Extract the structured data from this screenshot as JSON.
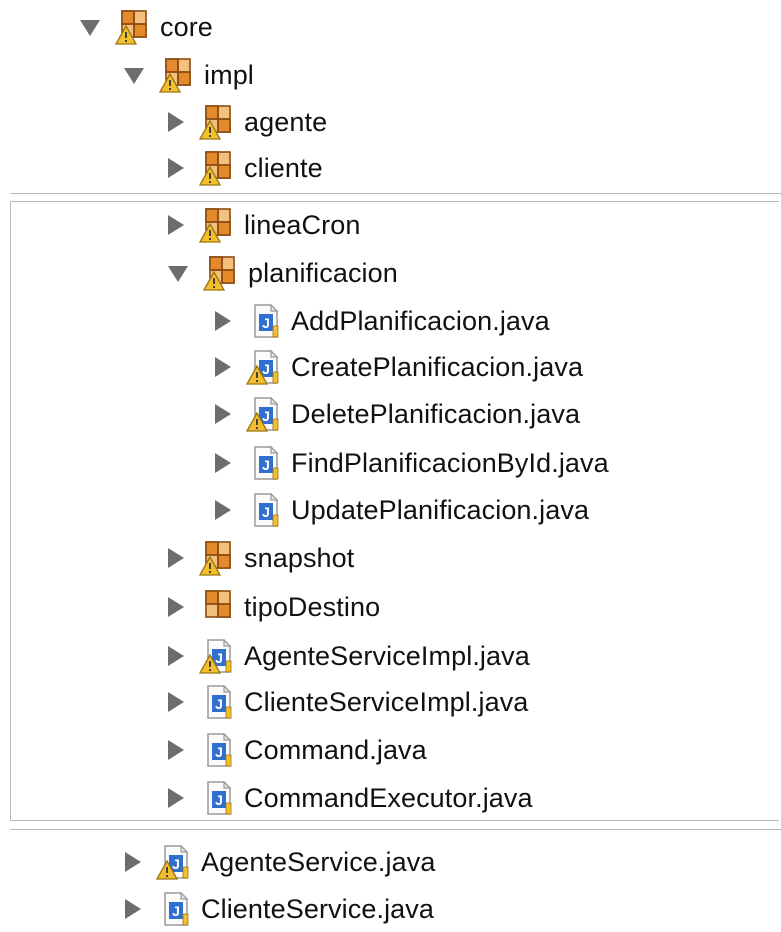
{
  "tree": {
    "core": {
      "label": "core",
      "icon": "package-warning-icon",
      "state": "expanded"
    },
    "impl": {
      "label": "impl",
      "icon": "package-warning-icon",
      "state": "expanded"
    },
    "agente": {
      "label": "agente",
      "icon": "package-warning-icon",
      "state": "collapsed"
    },
    "cliente": {
      "label": "cliente",
      "icon": "package-warning-icon",
      "state": "collapsed"
    },
    "lineaCron": {
      "label": "lineaCron",
      "icon": "package-warning-icon",
      "state": "collapsed"
    },
    "planificacion": {
      "label": "planificacion",
      "icon": "package-warning-icon",
      "state": "expanded"
    },
    "addPlanificacion": {
      "label": "AddPlanificacion.java",
      "icon": "java-file-icon",
      "state": "collapsed"
    },
    "createPlanificacion": {
      "label": "CreatePlanificacion.java",
      "icon": "java-file-warning-icon",
      "state": "collapsed"
    },
    "deletePlanificacion": {
      "label": "DeletePlanificacion.java",
      "icon": "java-file-warning-icon",
      "state": "collapsed"
    },
    "findPlanificacionById": {
      "label": "FindPlanificacionById.java",
      "icon": "java-file-icon",
      "state": "collapsed"
    },
    "updatePlanificacion": {
      "label": "UpdatePlanificacion.java",
      "icon": "java-file-icon",
      "state": "collapsed"
    },
    "snapshot": {
      "label": "snapshot",
      "icon": "package-warning-icon",
      "state": "collapsed"
    },
    "tipoDestino": {
      "label": "tipoDestino",
      "icon": "package-icon",
      "state": "collapsed"
    },
    "agenteServiceImpl": {
      "label": "AgenteServiceImpl.java",
      "icon": "java-file-warning-icon",
      "state": "collapsed"
    },
    "clienteServiceImpl": {
      "label": "ClienteServiceImpl.java",
      "icon": "java-file-icon",
      "state": "collapsed"
    },
    "command": {
      "label": "Command.java",
      "icon": "java-file-icon",
      "state": "collapsed"
    },
    "commandExecutor": {
      "label": "CommandExecutor.java",
      "icon": "java-file-icon",
      "state": "collapsed"
    },
    "agenteService": {
      "label": "AgenteService.java",
      "icon": "java-file-warning-icon",
      "state": "collapsed"
    },
    "clienteService": {
      "label": "ClienteService.java",
      "icon": "java-file-icon",
      "state": "collapsed"
    }
  },
  "colors": {
    "package_orange": "#d9822b",
    "package_brown": "#8a4b12",
    "java_blue": "#2f6fd1",
    "warning_yellow": "#f2c02e",
    "twisty_gray": "#6d6d6d"
  }
}
